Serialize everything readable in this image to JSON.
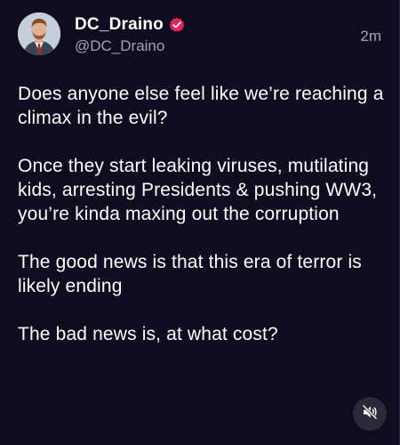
{
  "post": {
    "author": {
      "display_name": "DC_Draino",
      "handle": "@DC_Draino",
      "verified_icon": "verified-badge-icon",
      "badge_color": "#e0245e"
    },
    "timestamp": "2m",
    "paragraphs": [
      "Does anyone else feel like we’re reaching a climax in the evil?",
      "Once they start leaking viruses, mutilating kids, arresting Presidents & pushing WW3, you’re kinda maxing out the corruption",
      "The good news is that this era of terror is likely ending",
      "The bad news is, at what cost?"
    ]
  },
  "media_controls": {
    "mute_icon": "speaker-muted-icon"
  },
  "theme": {
    "background": "#100c1f",
    "text": "#ffffff",
    "secondary_text": "#a7a3b5"
  }
}
